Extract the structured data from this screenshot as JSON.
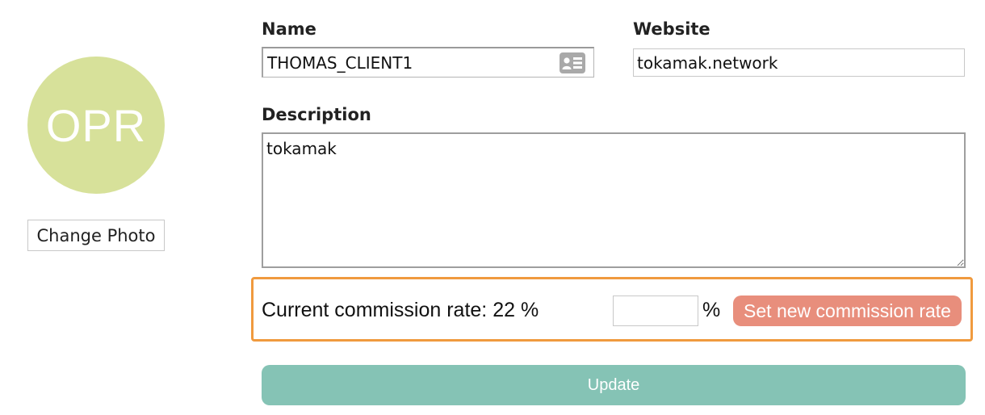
{
  "profile": {
    "avatar_initials": "OPR",
    "avatar_color": "#d7e19a",
    "change_photo_label": "Change Photo"
  },
  "form": {
    "name_label": "Name",
    "name_value": "THOMAS_CLIENT1",
    "name_icon": "contact-card-icon",
    "website_label": "Website",
    "website_value": "tokamak.network",
    "description_label": "Description",
    "description_value": "tokamak"
  },
  "commission": {
    "current_text": "Current commission rate: 22 %",
    "new_rate_value": "",
    "percent_sign": "%",
    "set_button_label": "Set new commission rate",
    "highlight_color": "#f09a3e",
    "button_color": "#e88e7c"
  },
  "update_button": {
    "label": "Update",
    "color": "#85c3b5"
  }
}
